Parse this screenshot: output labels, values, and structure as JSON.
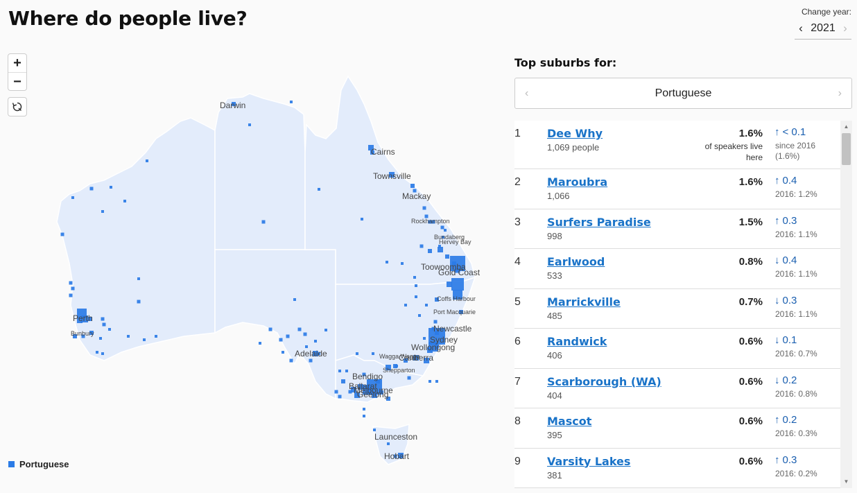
{
  "header": {
    "title": "Where do people live?"
  },
  "year": {
    "label": "Change year:",
    "value": "2021",
    "prev_icon": "chevron-left-icon",
    "next_icon": "chevron-right-icon"
  },
  "map": {
    "zoom_in": "+",
    "zoom_out": "−",
    "reset_icon": "reset-view-icon",
    "fill_color": "#e3ecfb",
    "border_color": "#ffffff",
    "dot_color": "#2b7be6",
    "cities": [
      "Darwin",
      "Cairns",
      "Townsville",
      "Mackay",
      "Rockhampton",
      "Bundaberg",
      "Hervey Bay",
      "Toowoomba",
      "Gold Coast",
      "Coffs Harbour",
      "Port Macquarie",
      "Newcastle",
      "Sydney",
      "Wollongong",
      "Canberra",
      "Wagga Wagga",
      "Shepparton",
      "Bendigo",
      "Ballarat",
      "Melbourne",
      "Geelong",
      "Adelaide",
      "Perth",
      "Bunbury",
      "Launceston",
      "Hobart"
    ]
  },
  "legend": {
    "label": "Portuguese",
    "color": "#2b7be6"
  },
  "panel": {
    "heading": "Top suburbs for:",
    "language": "Portuguese",
    "prev_icon": "chevron-left-icon",
    "next_icon": "chevron-right-icon"
  },
  "suburbs": [
    {
      "rank": "1",
      "name": "Dee Why",
      "count": "1,069 people",
      "pct": "1.6%",
      "pct_note": "of speakers live here",
      "dir": "↑",
      "change": "< 0.1",
      "since": "since 2016 (1.6%)"
    },
    {
      "rank": "2",
      "name": "Maroubra",
      "count": "1,066",
      "pct": "1.6%",
      "pct_note": "",
      "dir": "↑",
      "change": "0.4",
      "since": "2016: 1.2%"
    },
    {
      "rank": "3",
      "name": "Surfers Paradise",
      "count": "998",
      "pct": "1.5%",
      "pct_note": "",
      "dir": "↑",
      "change": "0.3",
      "since": "2016: 1.1%"
    },
    {
      "rank": "4",
      "name": "Earlwood",
      "count": "533",
      "pct": "0.8%",
      "pct_note": "",
      "dir": "↓",
      "change": "0.4",
      "since": "2016: 1.1%"
    },
    {
      "rank": "5",
      "name": "Marrickville",
      "count": "485",
      "pct": "0.7%",
      "pct_note": "",
      "dir": "↓",
      "change": "0.3",
      "since": "2016: 1.1%"
    },
    {
      "rank": "6",
      "name": "Randwick",
      "count": "406",
      "pct": "0.6%",
      "pct_note": "",
      "dir": "↓",
      "change": "0.1",
      "since": "2016: 0.7%"
    },
    {
      "rank": "7",
      "name": "Scarborough (WA)",
      "count": "404",
      "pct": "0.6%",
      "pct_note": "",
      "dir": "↓",
      "change": "0.2",
      "since": "2016: 0.8%"
    },
    {
      "rank": "8",
      "name": "Mascot",
      "count": "395",
      "pct": "0.6%",
      "pct_note": "",
      "dir": "↑",
      "change": "0.2",
      "since": "2016: 0.3%"
    },
    {
      "rank": "9",
      "name": "Varsity Lakes",
      "count": "381",
      "pct": "0.6%",
      "pct_note": "",
      "dir": "↑",
      "change": "0.3",
      "since": "2016: 0.2%"
    }
  ]
}
